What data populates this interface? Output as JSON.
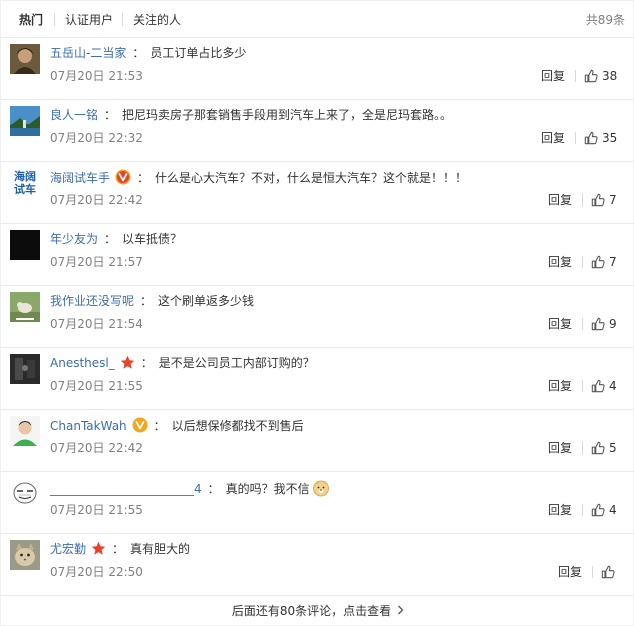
{
  "tabs": [
    {
      "label": "热门",
      "active": true
    },
    {
      "label": "认证用户",
      "active": false
    },
    {
      "label": "关注的人",
      "active": false
    }
  ],
  "total_label": "共89条",
  "comments": [
    {
      "user": "五岳山-二当家",
      "text": "员工订单占比多少",
      "time": "07月20日 21:53",
      "reply": "回复",
      "likes": "38",
      "badge": "none",
      "avatar_icon": "person-photo-avatar"
    },
    {
      "user": "良人一铭",
      "text": "把尼玛卖房子那套销售手段用到汽车上来了，全是尼玛套路。。",
      "time": "07月20日 22:32",
      "reply": "回复",
      "likes": "35",
      "badge": "none",
      "avatar_icon": "landscape-photo-avatar"
    },
    {
      "user": "海阔试车手",
      "text": "什么是心大汽车？不对，什么是恒大汽车？这个就是！！！",
      "time": "07月20日 22:42",
      "reply": "回复",
      "likes": "7",
      "badge": "verified-v-red",
      "avatar_icon": "text-logo-avatar",
      "avatar_text": [
        "海阔",
        "试车"
      ]
    },
    {
      "user": "年少友为",
      "text": "以车抵债？",
      "time": "07月20日 21:57",
      "reply": "回复",
      "likes": "7",
      "badge": "none",
      "avatar_icon": "black-avatar"
    },
    {
      "user": "我作业还没写呢",
      "text": "这个刷单返多少钱",
      "time": "07月20日 21:54",
      "reply": "回复",
      "likes": "9",
      "badge": "none",
      "avatar_icon": "animal-photo-avatar"
    },
    {
      "user": "Anesthesl_",
      "text": "是不是公司员工内部订购的？",
      "time": "07月20日 21:55",
      "reply": "回复",
      "likes": "4",
      "badge": "star",
      "avatar_icon": "dark-photo-avatar"
    },
    {
      "user": "ChanTakWah",
      "text": "以后想保修都找不到售后",
      "time": "07月20日 22:42",
      "reply": "回复",
      "likes": "5",
      "badge": "verified-v-gold",
      "avatar_icon": "person-white-avatar"
    },
    {
      "user": "________________________4",
      "text": "真的吗？我不信",
      "time": "07月20日 21:55",
      "reply": "回复",
      "likes": "4",
      "badge": "none",
      "avatar_icon": "sketch-face-avatar",
      "emoji": "doge-emoji"
    },
    {
      "user": "尤宏勤",
      "text": "真有胆大的",
      "time": "07月20日 22:50",
      "reply": "回复",
      "likes": "",
      "badge": "star",
      "avatar_icon": "cat-photo-avatar"
    }
  ],
  "footer": {
    "label": "后面还有80条评论，点击查看"
  },
  "colors": {
    "link": "#3b6db0",
    "muted": "#808080",
    "star": "#e8412c",
    "v_red": "#e8412c",
    "v_gold": "#f3a51c"
  }
}
